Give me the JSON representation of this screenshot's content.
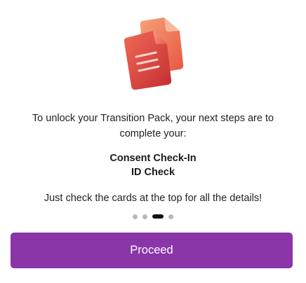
{
  "illustration": {
    "icon": "documents-icon",
    "colors": [
      "#f2856a",
      "#e0473d",
      "#c93236"
    ]
  },
  "message": "To unlock your Transition Pack, your next steps are to complete your:",
  "steps": [
    "Consent Check-In",
    "ID Check"
  ],
  "hint": "Just check the cards at the top for all the details!",
  "pagination": {
    "total": 4,
    "current": 3
  },
  "proceed_button": {
    "label": "Proceed",
    "color": "#8a35a8"
  }
}
